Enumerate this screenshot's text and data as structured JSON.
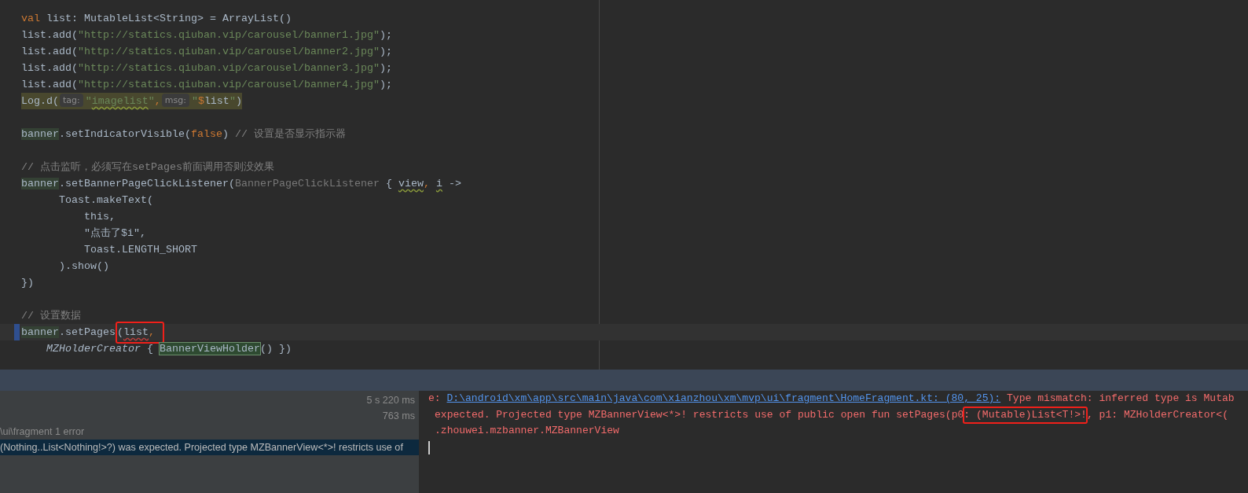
{
  "editor": {
    "lines": [
      {
        "kind": "code",
        "current": false,
        "changed": false,
        "emphasis": false,
        "tokens": [
          {
            "text": "val",
            "kind": "keyword"
          },
          {
            "text": " list: MutableList<String> = ArrayList()",
            "kind": "plain"
          }
        ]
      },
      {
        "kind": "code",
        "current": false,
        "changed": false,
        "emphasis": false,
        "tokens": [
          {
            "text": "list.add(",
            "kind": "plain"
          },
          {
            "text": "\"http://statics.qiuban.vip/carousel/banner1.jpg\"",
            "kind": "string"
          },
          {
            "text": ");",
            "kind": "plain"
          }
        ]
      },
      {
        "kind": "code",
        "current": false,
        "changed": false,
        "emphasis": false,
        "tokens": [
          {
            "text": "list.add(",
            "kind": "plain"
          },
          {
            "text": "\"http://statics.qiuban.vip/carousel/banner2.jpg\"",
            "kind": "string"
          },
          {
            "text": ");",
            "kind": "plain"
          }
        ]
      },
      {
        "kind": "code",
        "current": false,
        "changed": false,
        "emphasis": false,
        "tokens": [
          {
            "text": "list.add(",
            "kind": "plain"
          },
          {
            "text": "\"http://statics.qiuban.vip/carousel/banner3.jpg\"",
            "kind": "string"
          },
          {
            "text": ");",
            "kind": "plain"
          }
        ]
      },
      {
        "kind": "code",
        "current": false,
        "changed": false,
        "emphasis": false,
        "tokens": [
          {
            "text": "list.add(",
            "kind": "plain"
          },
          {
            "text": "\"http://statics.qiuban.vip/carousel/banner4.jpg\"",
            "kind": "string"
          },
          {
            "text": ");",
            "kind": "plain"
          }
        ]
      },
      {
        "kind": "code",
        "current": false,
        "changed": false,
        "emphasis": true,
        "tokens": [
          {
            "text": "Log.d(",
            "kind": "plain"
          },
          {
            "text": "tag:",
            "kind": "hint"
          },
          {
            "text": "\"",
            "kind": "string"
          },
          {
            "text": "imagelist",
            "kind": "string",
            "warning_underline": true
          },
          {
            "text": "\"",
            "kind": "string"
          },
          {
            "text": ",",
            "kind": "keyword"
          },
          {
            "text": "msg:",
            "kind": "hint"
          },
          {
            "text": "\"",
            "kind": "string"
          },
          {
            "text": "$",
            "kind": "keyword"
          },
          {
            "text": "list",
            "kind": "plain"
          },
          {
            "text": "\"",
            "kind": "string"
          },
          {
            "text": ")",
            "kind": "plain"
          }
        ]
      },
      {
        "kind": "blank",
        "current": false,
        "changed": false,
        "emphasis": false
      },
      {
        "kind": "code",
        "current": false,
        "changed": false,
        "emphasis": false,
        "tokens": [
          {
            "text": "banner",
            "kind": "plain",
            "usage_highlight": true
          },
          {
            "text": ".setIndicatorVisible(",
            "kind": "plain"
          },
          {
            "text": "false",
            "kind": "keyword"
          },
          {
            "text": ")",
            "kind": "plain"
          },
          {
            "text": " // 设置是否显示指示器",
            "kind": "comment"
          }
        ]
      },
      {
        "kind": "blank",
        "current": false,
        "changed": false,
        "emphasis": false
      },
      {
        "kind": "code",
        "current": false,
        "changed": false,
        "emphasis": false,
        "tokens": [
          {
            "text": "// 点击监听，必须写在setPages前面调用否则没效果",
            "kind": "comment"
          }
        ]
      },
      {
        "kind": "code",
        "current": false,
        "changed": false,
        "emphasis": false,
        "tokens": [
          {
            "text": "banner",
            "kind": "plain",
            "usage_highlight": true
          },
          {
            "text": ".setBannerPageClickListener(",
            "kind": "plain"
          },
          {
            "text": "BannerPageClickListener",
            "kind": "sam"
          },
          {
            "text": " { ",
            "kind": "plain"
          },
          {
            "text": "view",
            "kind": "plain",
            "warning_underline": true
          },
          {
            "text": ", ",
            "kind": "keyword"
          },
          {
            "text": "i",
            "kind": "plain",
            "warning_underline": true
          },
          {
            "text": " ->",
            "kind": "plain"
          }
        ]
      },
      {
        "kind": "code",
        "current": false,
        "changed": false,
        "emphasis": false,
        "tokens": [
          {
            "text": "      Toast.makeText(",
            "kind": "plain"
          }
        ]
      },
      {
        "kind": "code",
        "current": false,
        "changed": false,
        "emphasis": false,
        "tokens": [
          {
            "text": "          this,",
            "kind": "plain"
          }
        ]
      },
      {
        "kind": "code",
        "current": false,
        "changed": false,
        "emphasis": false,
        "tokens": [
          {
            "text": "          \"点击了$i\",",
            "kind": "plain"
          }
        ]
      },
      {
        "kind": "code",
        "current": false,
        "changed": false,
        "emphasis": false,
        "tokens": [
          {
            "text": "          Toast.LENGTH_SHORT",
            "kind": "plain"
          }
        ]
      },
      {
        "kind": "code",
        "current": false,
        "changed": false,
        "emphasis": false,
        "tokens": [
          {
            "text": "      ).show()",
            "kind": "plain"
          }
        ]
      },
      {
        "kind": "code",
        "current": false,
        "changed": false,
        "emphasis": false,
        "tokens": [
          {
            "text": "})",
            "kind": "plain"
          }
        ]
      },
      {
        "kind": "blank",
        "current": false,
        "changed": false,
        "emphasis": false
      },
      {
        "kind": "code",
        "current": false,
        "changed": false,
        "emphasis": false,
        "tokens": [
          {
            "text": "// 设置数据",
            "kind": "comment"
          }
        ]
      },
      {
        "kind": "code",
        "current": true,
        "changed": true,
        "emphasis": false,
        "tokens": [
          {
            "text": "banner",
            "kind": "plain",
            "usage_highlight": true
          },
          {
            "text": ".setPages",
            "kind": "plain"
          },
          {
            "kind": "annotation",
            "tokens": [
              {
                "text": "(",
                "kind": "plain"
              },
              {
                "text": "list",
                "kind": "plain",
                "error_underline": true
              },
              {
                "text": ",",
                "kind": "keyword"
              }
            ]
          }
        ]
      },
      {
        "kind": "code",
        "current": false,
        "changed": false,
        "emphasis": false,
        "tokens": [
          {
            "text": "    MZHolderCreator",
            "kind": "italic"
          },
          {
            "text": " { ",
            "kind": "plain"
          },
          {
            "text": "BannerViewHolder",
            "kind": "plain",
            "match_highlight": true
          },
          {
            "text": "() })",
            "kind": "plain"
          }
        ]
      }
    ]
  },
  "build_panel": {
    "rows": [
      {
        "time": "5 s 220 ms",
        "selected": false
      },
      {
        "time": "763 ms",
        "selected": false
      },
      {
        "label": "\\ui\\fragment 1 error",
        "selected": false
      },
      {
        "label": "(Nothing..List<Nothing!>?) was expected. Projected type MZBannerView<*>! restricts use of",
        "selected": true
      }
    ]
  },
  "console": {
    "lines": [
      {
        "kind": "message",
        "parts": [
          {
            "text": "e: ",
            "kind": "text"
          },
          {
            "text": "D:\\android\\xm\\app\\src\\main\\java\\com\\xianzhou\\xm\\mvp\\ui\\fragment\\HomeFragment.kt: (80, 25):",
            "kind": "link"
          },
          {
            "text": " Type mismatch: inferred type is Mutab",
            "kind": "text"
          }
        ]
      },
      {
        "kind": "continuation",
        "parts": [
          {
            "text": "expected. Projected type MZBannerView<*>! restricts use of public open fun setPages(p0",
            "kind": "text"
          },
          {
            "text": ": (Mutable)List<T!>!",
            "kind": "annotation"
          },
          {
            "text": ", p1: MZHolderCreator<(",
            "kind": "text"
          }
        ]
      },
      {
        "kind": "continuation",
        "parts": [
          {
            "text": ".zhouwei.mzbanner.MZBannerView",
            "kind": "text"
          }
        ]
      },
      {
        "kind": "cursor"
      }
    ]
  }
}
